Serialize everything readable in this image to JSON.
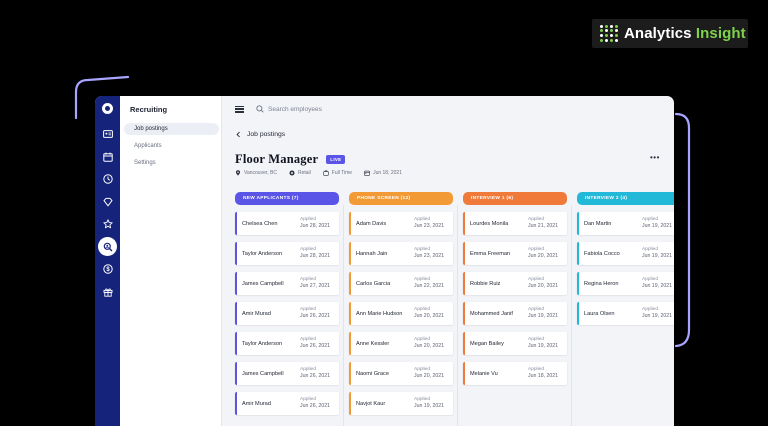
{
  "brand": {
    "name_part1": "Analytics",
    "name_part2": "Insight",
    "accent": "#7fd14c"
  },
  "colors": {
    "rail": "#15237a",
    "accent_live": "#5a55e6",
    "deco_line": "#a9a5ff"
  },
  "rail": {
    "icons": [
      "id-card-icon",
      "calendar-icon",
      "clock-icon",
      "diamond-icon",
      "star-icon",
      "recruiting-search-icon",
      "dollar-icon",
      "gift-icon"
    ],
    "active_index": 5
  },
  "subnav": {
    "title": "Recruiting",
    "items": [
      "Job postings",
      "Applicants",
      "Settings"
    ],
    "active_index": 0
  },
  "search": {
    "placeholder": "Search employees"
  },
  "breadcrumb": {
    "back_label": "Job postings"
  },
  "job": {
    "title": "Floor Manager",
    "status": "LIVE",
    "location": "Vancouver, BC",
    "department": "Retail",
    "type": "Full Time",
    "date": "Jun 18, 2021"
  },
  "board": {
    "columns": [
      {
        "label": "NEW APPLICANTS (7)",
        "color": "#5a55e6",
        "cards": [
          {
            "name": "Chelsea Chen",
            "applied": "Applied",
            "date": "Jun 28, 2021"
          },
          {
            "name": "Taylor Anderson",
            "applied": "Applied",
            "date": "Jun 28, 2021"
          },
          {
            "name": "James Campbell",
            "applied": "Applied",
            "date": "Jun 27, 2021"
          },
          {
            "name": "Amir Murad",
            "applied": "Applied",
            "date": "Jun 26, 2021"
          },
          {
            "name": "Taylor Anderson",
            "applied": "Applied",
            "date": "Jun 26, 2021"
          },
          {
            "name": "James Campbell",
            "applied": "Applied",
            "date": "Jun 26, 2021"
          },
          {
            "name": "Amir Murad",
            "applied": "Applied",
            "date": "Jun 26, 2021"
          }
        ]
      },
      {
        "label": "PHONE SCREEN (12)",
        "color": "#f29a35",
        "cards": [
          {
            "name": "Adam Davis",
            "applied": "Applied",
            "date": "Jun 23, 2021"
          },
          {
            "name": "Hannah Jain",
            "applied": "Applied",
            "date": "Jun 23, 2021"
          },
          {
            "name": "Carlos Garcia",
            "applied": "Applied",
            "date": "Jun 22, 2021"
          },
          {
            "name": "Ann Marie Hudson",
            "applied": "Applied",
            "date": "Jun 20, 2021"
          },
          {
            "name": "Anne Kessler",
            "applied": "Applied",
            "date": "Jun 20, 2021"
          },
          {
            "name": "Naomi Grace",
            "applied": "Applied",
            "date": "Jun 20, 2021"
          },
          {
            "name": "Navjot Kaur",
            "applied": "Applied",
            "date": "Jun 19, 2021"
          }
        ]
      },
      {
        "label": "INTERVIEW 1 (6)",
        "color": "#f07a3a",
        "cards": [
          {
            "name": "Lourdes Monila",
            "applied": "Applied",
            "date": "Jun 21, 2021"
          },
          {
            "name": "Emma Freeman",
            "applied": "Applied",
            "date": "Jun 20, 2021"
          },
          {
            "name": "Robbie Ruiz",
            "applied": "Applied",
            "date": "Jun 20, 2021"
          },
          {
            "name": "Mohammed Janif",
            "applied": "Applied",
            "date": "Jun 19, 2021"
          },
          {
            "name": "Megan Bailey",
            "applied": "Applied",
            "date": "Jun 19, 2021"
          },
          {
            "name": "Melanie Vu",
            "applied": "Applied",
            "date": "Jun 18, 2021"
          }
        ]
      },
      {
        "label": "INTERVIEW 2 (4)",
        "color": "#22b8d8",
        "cards": [
          {
            "name": "Dan Martin",
            "applied": "Applied",
            "date": "Jun 19, 2021"
          },
          {
            "name": "Fabiola Cocco",
            "applied": "Applied",
            "date": "Jun 19, 2021"
          },
          {
            "name": "Regina Heron",
            "applied": "Applied",
            "date": "Jun 19, 2021"
          },
          {
            "name": "Laura Olsen",
            "applied": "Applied",
            "date": "Jun 19, 2021"
          }
        ]
      }
    ]
  }
}
